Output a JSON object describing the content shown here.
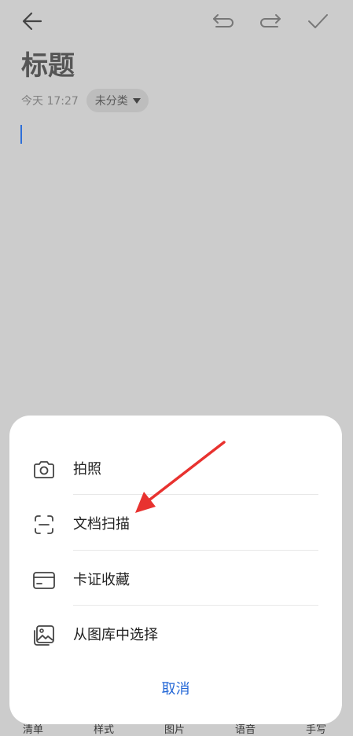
{
  "note": {
    "title": "标题",
    "timestamp": "今天 17:27",
    "category": "未分类"
  },
  "toolbar": {
    "items": [
      "清单",
      "样式",
      "图片",
      "语音",
      "手写"
    ]
  },
  "sheet": {
    "options": [
      {
        "label": "拍照",
        "icon": "camera-icon"
      },
      {
        "label": "文档扫描",
        "icon": "scan-icon"
      },
      {
        "label": "卡证收藏",
        "icon": "card-icon"
      },
      {
        "label": "从图库中选择",
        "icon": "gallery-icon"
      }
    ],
    "cancel_label": "取消"
  },
  "colors": {
    "accent": "#2266d6",
    "annotation_arrow": "#e8322f",
    "dim_background": "#cccccc"
  }
}
